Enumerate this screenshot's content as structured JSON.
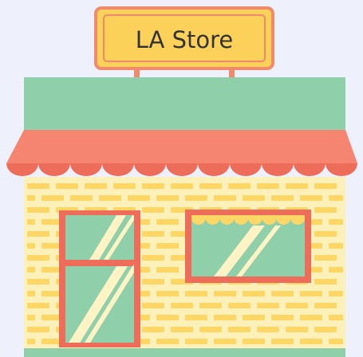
{
  "store": {
    "sign_text": "LA Store"
  },
  "colors": {
    "background": "#eef1fb",
    "sign_fill": "#fcd15a",
    "sign_border": "#f08a6a",
    "sign_text": "#333333",
    "roof": "#8fcfaa",
    "awning": "#f58470",
    "awning_dark": "#ee6c5a",
    "wall": "#fdf0b8",
    "brick": "#fcd766",
    "frame": "#ee6c5a",
    "glass": "#8fcfaa",
    "glare": "#fef3c4",
    "ground": "#8fcfaa"
  },
  "icons": [
    "storefront-illustration"
  ]
}
